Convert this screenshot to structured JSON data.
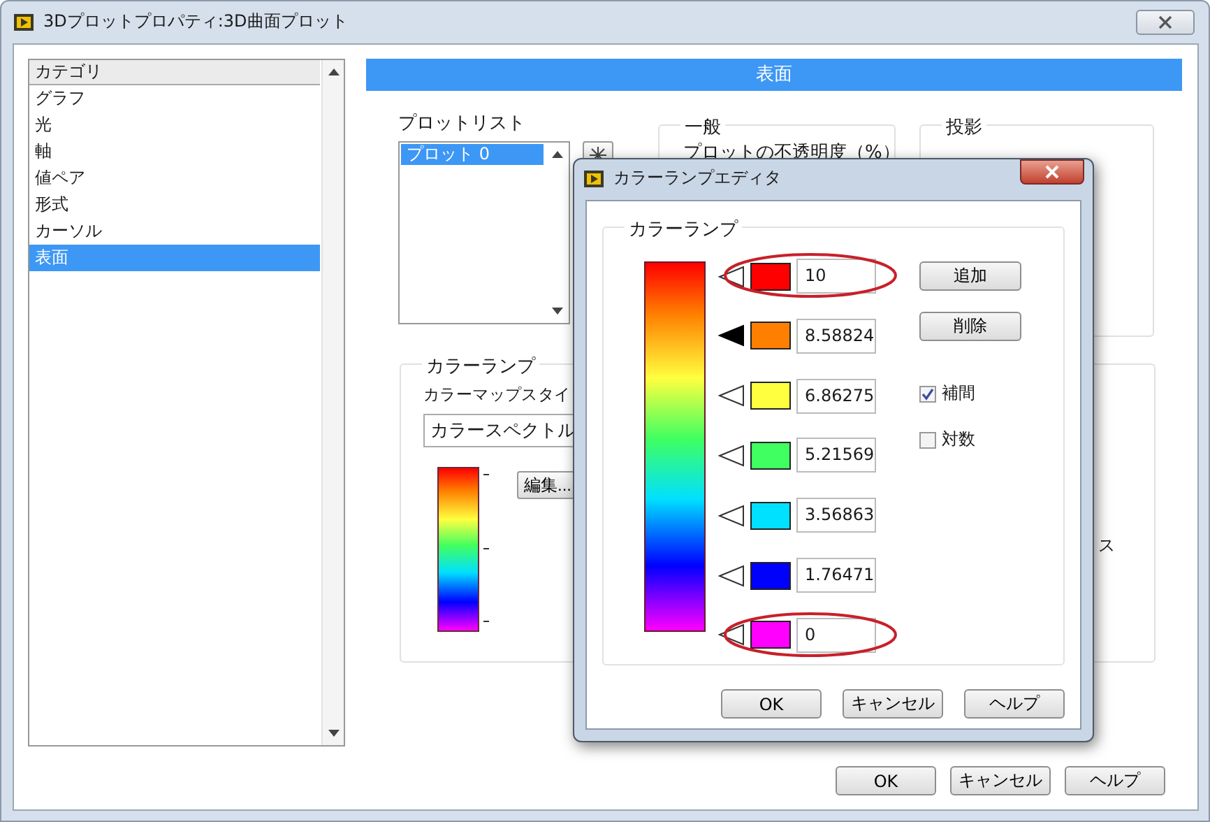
{
  "window": {
    "title": "3Dプロットプロパティ:3D曲面プロット"
  },
  "categories": {
    "header": "カテゴリ",
    "items": [
      {
        "label": "グラフ",
        "selected": false
      },
      {
        "label": "光",
        "selected": false
      },
      {
        "label": "軸",
        "selected": false
      },
      {
        "label": "値ペア",
        "selected": false
      },
      {
        "label": "形式",
        "selected": false
      },
      {
        "label": "カーソル",
        "selected": false
      },
      {
        "label": "表面",
        "selected": true
      }
    ]
  },
  "panel_header": "表面",
  "plot_list": {
    "label": "プロットリスト",
    "items": [
      {
        "label": "プロット 0",
        "selected": true
      }
    ]
  },
  "general": {
    "title": "一般",
    "label": "プロットの不透明度（%）"
  },
  "projection": {
    "title": "投影"
  },
  "color_ramp": {
    "title": "カラーランプ",
    "style_label": "カラーマップスタイ",
    "style_value": "カラースペクトル",
    "edit_button": "編集...",
    "fragment": "ス"
  },
  "buttons": [
    "OK",
    "キャンセル",
    "ヘルプ"
  ],
  "dialog": {
    "title": "カラーランプエディタ",
    "group_title": "カラーランプ",
    "markers": [
      {
        "color": "#ff0000",
        "value": "10",
        "selected": false,
        "highlighted": true
      },
      {
        "color": "#ff8000",
        "value": "8.58824",
        "selected": true,
        "highlighted": false
      },
      {
        "color": "#ffff40",
        "value": "6.86275",
        "selected": false,
        "highlighted": false
      },
      {
        "color": "#40ff60",
        "value": "5.21569",
        "selected": false,
        "highlighted": false
      },
      {
        "color": "#00e0ff",
        "value": "3.56863",
        "selected": false,
        "highlighted": false
      },
      {
        "color": "#0000ff",
        "value": "1.76471",
        "selected": false,
        "highlighted": false
      },
      {
        "color": "#ff00ff",
        "value": "0",
        "selected": false,
        "highlighted": true
      }
    ],
    "add_button": "追加",
    "delete_button": "削除",
    "options": [
      {
        "label": "補間",
        "checked": true
      },
      {
        "label": "対数",
        "checked": false
      }
    ],
    "buttons": [
      "OK",
      "キャンセル",
      "ヘルプ"
    ]
  }
}
